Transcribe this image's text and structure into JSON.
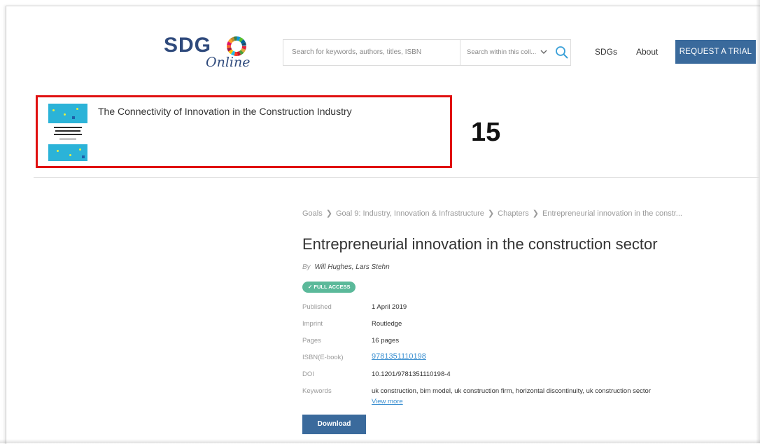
{
  "header": {
    "logo_text": "SDG",
    "logo_subtext": "Online",
    "search_placeholder": "Search for keywords, authors, titles, ISBN",
    "search_scope": "Search within this coll...",
    "nav": [
      "SDGs",
      "About"
    ],
    "trial_button": "REQUEST A TRIAL"
  },
  "book": {
    "title": "The Connectivity of Innovation in the Construction Industry",
    "annotation_number": "15"
  },
  "breadcrumb": [
    "Goals",
    "Goal 9: Industry, Innovation & Infrastructure",
    "Chapters",
    "Entrepreneurial innovation in the constr..."
  ],
  "chapter": {
    "title": "Entrepreneurial innovation in the construction sector",
    "by_label": "By",
    "authors": "Will Hughes, Lars Stehn",
    "access_badge": "✓ FULL ACCESS"
  },
  "metadata": [
    {
      "label": "Published",
      "value": "1 April 2019"
    },
    {
      "label": "Imprint",
      "value": "Routledge"
    },
    {
      "label": "Pages",
      "value": "16 pages"
    },
    {
      "label": "ISBN(E-book)",
      "value": "9781351110198"
    },
    {
      "label": "DOI",
      "value": "10.1201/9781351110198-4"
    },
    {
      "label": "Keywords",
      "value": "uk construction, bim model, uk construction firm, horizontal discontinuity, uk construction sector"
    }
  ],
  "view_more": "View more",
  "download_button": "Download",
  "colors": {
    "brand_blue": "#3a6a9c",
    "highlight_red": "#e01010",
    "badge_green": "#5bb99a",
    "link_blue": "#3a8fd0"
  }
}
